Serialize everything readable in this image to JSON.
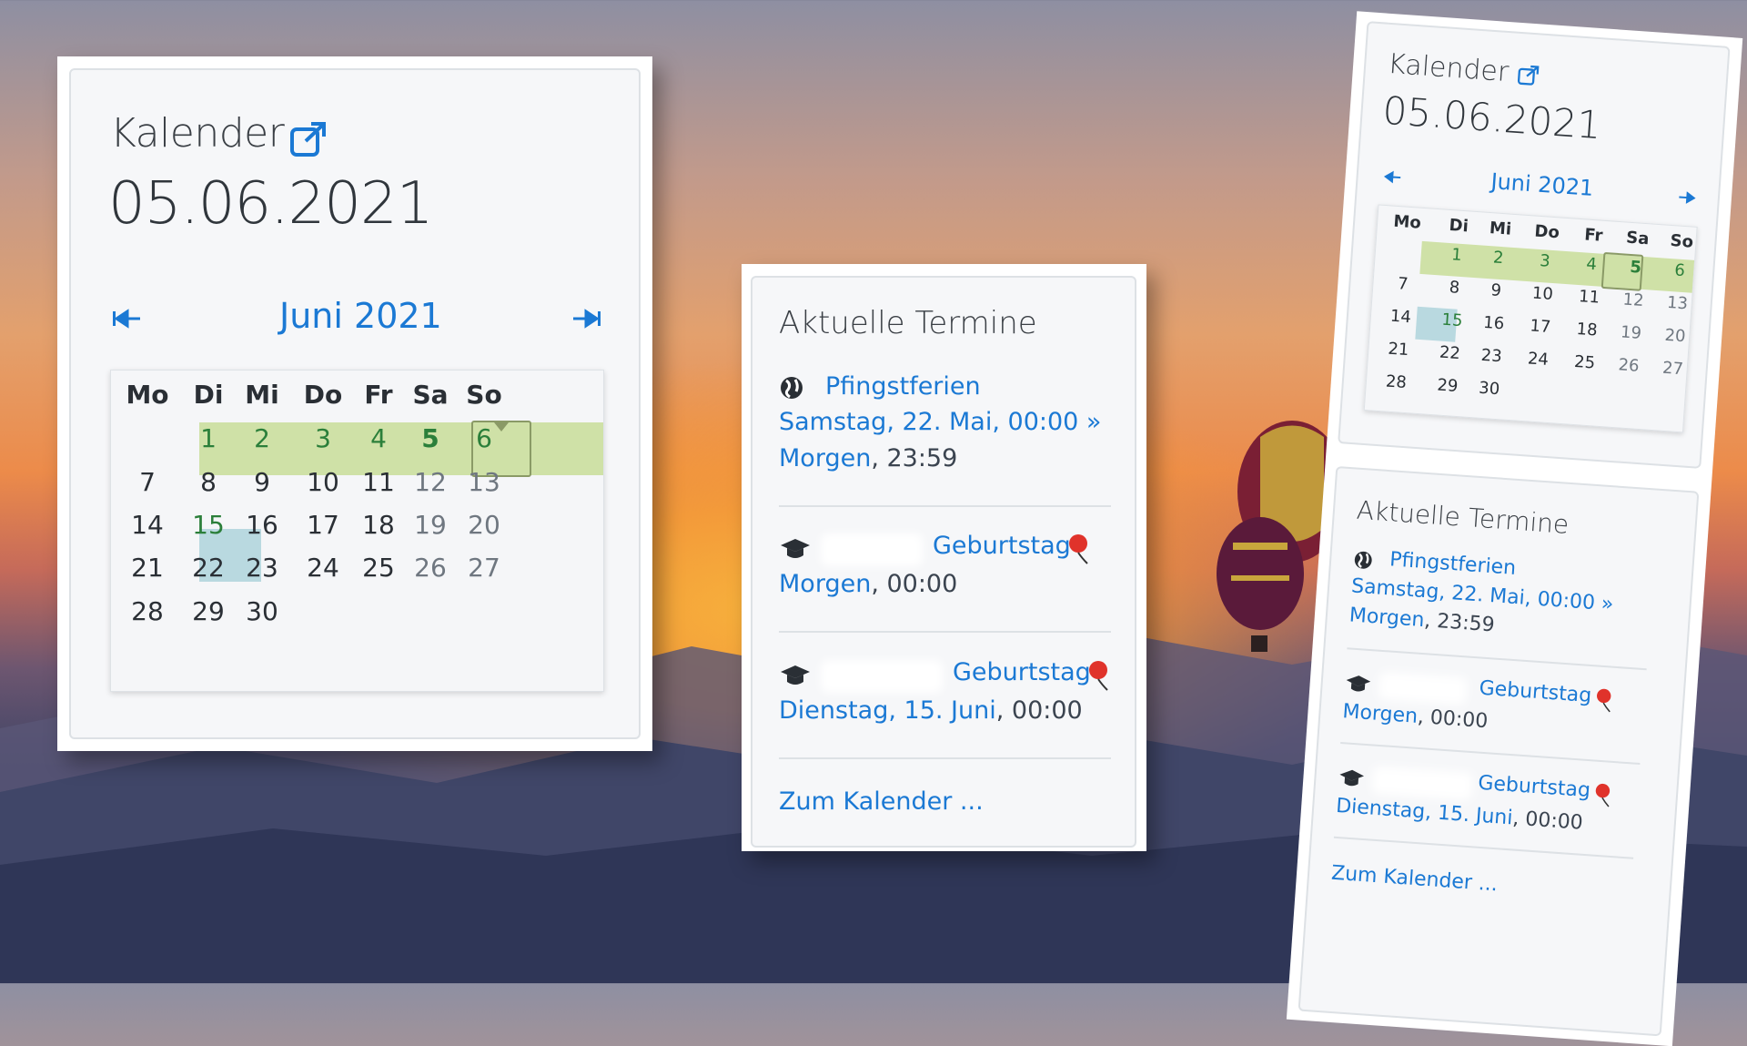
{
  "calendar": {
    "title": "Kalender",
    "date": "05.06.2021",
    "month": "Juni 2021",
    "prev_icon": "arrow-left-icon",
    "next_icon": "arrow-right-icon",
    "weekdays": [
      "Mo",
      "Di",
      "Mi",
      "Do",
      "Fr",
      "Sa",
      "So"
    ],
    "weeks": [
      [
        "",
        "1",
        "2",
        "3",
        "4",
        "5",
        "6"
      ],
      [
        "7",
        "8",
        "9",
        "10",
        "11",
        "12",
        "13"
      ],
      [
        "14",
        "15",
        "16",
        "17",
        "18",
        "19",
        "20"
      ],
      [
        "21",
        "22",
        "23",
        "24",
        "25",
        "26",
        "27"
      ],
      [
        "28",
        "29",
        "30",
        "",
        "",
        "",
        ""
      ]
    ],
    "selected_day": "5",
    "today_day": "15"
  },
  "events": {
    "title": "Aktuelle Termine",
    "items": [
      {
        "icon": "globe-icon",
        "name": "Pfingstferien",
        "line1": "Samstag, 22. Mai, 00:00 »",
        "line2_link": "Morgen",
        "line2_rest": ", 23:59"
      },
      {
        "icon": "graduation-cap-icon",
        "name": "Geburtstag",
        "badge_icon": "balloon-icon",
        "line1_link": "Morgen",
        "line1_rest": ", 00:00"
      },
      {
        "icon": "graduation-cap-icon",
        "name": "Geburtstag",
        "badge_icon": "balloon-icon",
        "line1_link": "Dienstag, 15. Juni",
        "line1_rest": ", 00:00"
      }
    ],
    "footer_link": "Zum Kalender ..."
  },
  "colors": {
    "link": "#1b79d4",
    "week_highlight": "#cfe1a7",
    "today_highlight": "#b9d9e0"
  }
}
